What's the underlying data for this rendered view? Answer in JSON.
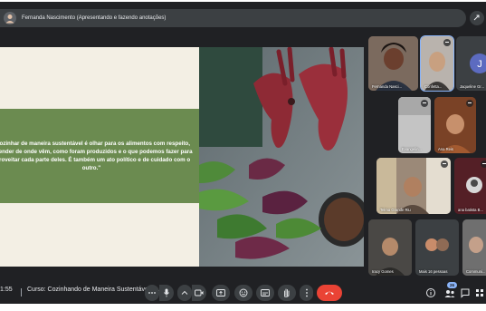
{
  "presenter": {
    "label": "Fernanda Nascimento (Apresentando e fazendo anotações)"
  },
  "slide": {
    "quote": "\"Cozinhar de maneira sustentável é olhar para os alimentos com respeito, entender de onde vêm, como foram produzidos e o que podemos fazer para aproveitar cada parte deles. É também um ato político e de cuidado com o outro.\""
  },
  "participants": [
    {
      "name": "Fernanda Nasci...",
      "icon": "avatar-photo"
    },
    {
      "name": "Confetta...",
      "icon": "avatar-photo"
    },
    {
      "name": "Jaqueline Gr...",
      "initial": "J",
      "color": "#5c6bc0"
    },
    {
      "name": "Evangelin...",
      "icon": "avatar-photo"
    },
    {
      "name": "Ana Reis",
      "icon": "avatar-photo"
    },
    {
      "name": "Telma Grande Riu",
      "icon": "avatar-photo"
    },
    {
      "name": "ana batista B...",
      "icon": "avatar-photo"
    },
    {
      "name": "Iracy Gomes",
      "icon": "avatar-photo"
    },
    {
      "name": "Mais 16 pessoas",
      "icon": "avatars-group"
    },
    {
      "name": "Communi...",
      "icon": "avatar-photo"
    }
  ],
  "bottom": {
    "time": "1:55",
    "meeting_title": "Curso: Cozinhando de Maneira Sustentável co...",
    "people_count": "26"
  },
  "colors": {
    "background": "#202124",
    "control": "#3c4043",
    "end_call": "#ea4335",
    "accent": "#8ab4f8",
    "quote_band": "#6b8b50"
  },
  "icons": [
    "more-icon",
    "mic-icon",
    "chevron-up-icon",
    "camera-icon",
    "present-icon",
    "emoji-icon",
    "captions-icon",
    "raise-hand-icon",
    "more-vert-icon",
    "end-call-icon",
    "info-icon",
    "people-icon",
    "chat-icon",
    "activities-icon"
  ]
}
